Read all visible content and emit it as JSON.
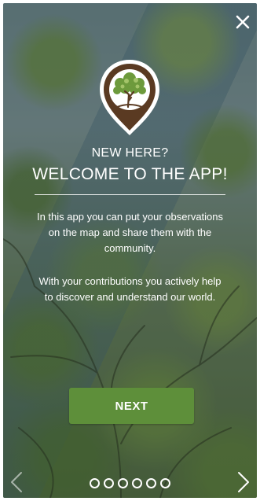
{
  "onboarding": {
    "heading_small": "NEW HERE?",
    "heading_large": "WELCOME TO THE APP!",
    "paragraph_1": "In this app you can put your observations on the map and share them with the community.",
    "paragraph_2": "With your contributions you actively help to discover and understand our world.",
    "next_button": "NEXT"
  },
  "pagination": {
    "pages": 6,
    "current": 1
  },
  "icons": {
    "close": "close-icon",
    "logo": "tree-logo-icon",
    "prev": "chevron-left-icon",
    "next": "chevron-right-icon"
  },
  "colors": {
    "accent": "#5e8f3a",
    "logo_brown": "#5a3a22",
    "text": "#ffffff"
  }
}
